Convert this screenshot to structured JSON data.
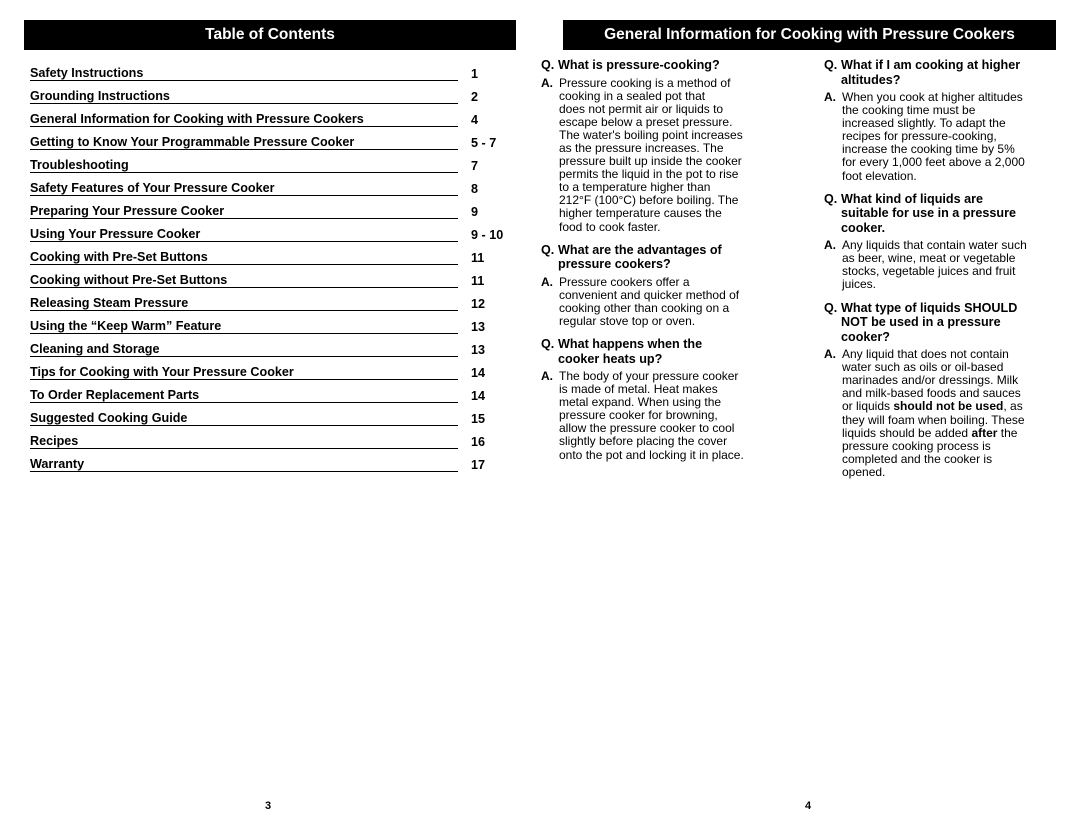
{
  "left_page": {
    "header": "Table of Contents",
    "page_number": "3",
    "toc": [
      {
        "title": "Safety Instructions",
        "page": "1"
      },
      {
        "title": "Grounding Instructions",
        "page": "2"
      },
      {
        "title": "General Information for Cooking with Pressure Cookers",
        "page": "4"
      },
      {
        "title": "Getting to Know Your Programmable Pressure Cooker",
        "page": "5 - 7"
      },
      {
        "title": "Troubleshooting",
        "page": "7"
      },
      {
        "title": "Safety Features of Your Pressure Cooker",
        "page": "8"
      },
      {
        "title": "Preparing Your Pressure Cooker",
        "page": "9"
      },
      {
        "title": "Using Your Pressure Cooker",
        "page": "9 - 10"
      },
      {
        "title": "Cooking with Pre-Set Buttons",
        "page": "11"
      },
      {
        "title": "Cooking without Pre-Set Buttons",
        "page": "11"
      },
      {
        "title": "Releasing Steam Pressure",
        "page": "12"
      },
      {
        "title": "Using the “Keep Warm” Feature",
        "page": "13"
      },
      {
        "title": "Cleaning and Storage",
        "page": "13"
      },
      {
        "title": "Tips for Cooking with Your Pressure Cooker",
        "page": "14"
      },
      {
        "title": "To Order Replacement Parts",
        "page": "14"
      },
      {
        "title": "Suggested Cooking Guide",
        "page": "15"
      },
      {
        "title": "Recipes",
        "page": "16"
      },
      {
        "title": "Warranty",
        "page": "17"
      }
    ]
  },
  "right_page": {
    "header": "General Information for Cooking with Pressure Cookers",
    "page_number": "4",
    "q_label": "Q.",
    "a_label": "A.",
    "columns": [
      [
        {
          "q": [
            "What is pressure-cooking?"
          ],
          "a": [
            "Pressure cooking is a method of",
            "cooking in a sealed pot that",
            "does not permit air or liquids to",
            "escape below a preset pressure.",
            "The water's boiling point increases",
            "as the pressure increases. The",
            "pressure built up inside the cooker",
            "permits the liquid in the pot to rise",
            "to a temperature higher than",
            "212°F (100°C) before boiling. The",
            "higher temperature causes the",
            "food to cook faster."
          ]
        },
        {
          "q": [
            "What are the advantages of",
            "pressure cookers?"
          ],
          "a": [
            "Pressure cookers offer a",
            "convenient and quicker method of",
            "cooking other than cooking on a",
            "regular stove top or oven."
          ]
        },
        {
          "q": [
            "What happens when the",
            "cooker heats up?"
          ],
          "a": [
            "The body of your pressure cooker",
            "is made of metal. Heat makes",
            "metal expand. When using the",
            "pressure cooker for browning,",
            "allow the pressure cooker to cool",
            "slightly before placing the cover",
            "onto the pot and locking it in place."
          ]
        }
      ],
      [
        {
          "q": [
            "What if I am cooking at higher",
            "altitudes?"
          ],
          "a": [
            "When you cook at higher altitudes",
            "the cooking time must be",
            "increased slightly. To adapt the",
            "recipes for pressure-cooking,",
            "increase the cooking time by 5%",
            "for every 1,000 feet above a 2,000",
            "foot elevation."
          ]
        },
        {
          "q": [
            "What kind of liquids are",
            "suitable for use in a pressure",
            "cooker."
          ],
          "a": [
            "Any liquids that contain water such",
            "as beer, wine, meat or vegetable",
            "stocks, vegetable juices and fruit",
            "juices."
          ]
        },
        {
          "q": [
            "What type of liquids SHOULD",
            "NOT be used in a pressure",
            "cooker?"
          ],
          "a": [
            "Any liquid that does not contain",
            "water such as oils or oil-based",
            "marinades and/or dressings. Milk",
            "and milk-based foods and sauces",
            [
              {
                "t": "or liquids "
              },
              {
                "t": "should not be used",
                "b": true
              },
              {
                "t": ", as"
              }
            ],
            "they will foam when boiling. These",
            [
              {
                "t": "liquids should be added "
              },
              {
                "t": "after",
                "b": true
              },
              {
                "t": " the"
              }
            ],
            "pressure cooking process is",
            "completed and the cooker is",
            "opened."
          ]
        }
      ]
    ]
  }
}
